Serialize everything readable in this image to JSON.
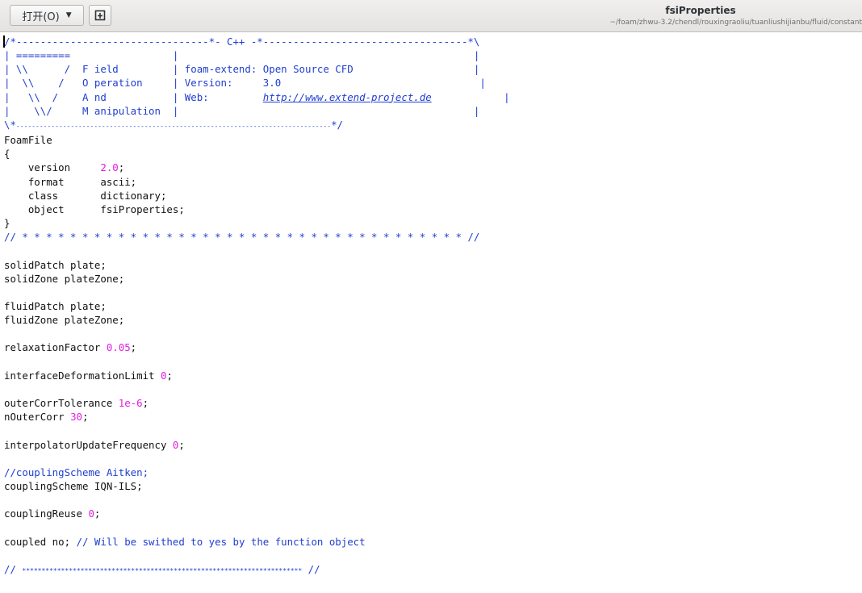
{
  "header": {
    "open_label": "打开(O)",
    "new_tab_icon": "new-document-icon",
    "title": "fsiProperties",
    "subtitle": "~/foam/zhwu-3.2/chendl/rouxingraoliu/tuanliushijianbu/fluid/constant"
  },
  "code": {
    "banner_top": "/*--------------------------------*- C++ -*----------------------------------*\\",
    "banner_l1": "| =========                 |                                                 |",
    "banner_l2a": "| \\\\      /  F ield         | ",
    "banner_l2b": "foam-extend: Open Source CFD",
    "banner_l2c": "                    |",
    "banner_l3a": "|  \\\\    /   O peration     | ",
    "banner_l3b": "Version:     3.0",
    "banner_l3c": "                                 |",
    "banner_l4a": "|   \\\\  /    A nd           | ",
    "banner_l4b": "Web:         ",
    "banner_l4url": "http://www.extend-project.de",
    "banner_l4c": "            |",
    "banner_l5": "|    \\\\/     M anipulation  |                                                 |",
    "banner_bottom_a": "\\*",
    "banner_bottom_dashes": "---------------------------------------------------------------------------------",
    "banner_bottom_b": "*/",
    "foamfile": "FoamFile",
    "open_brace": "{",
    "version_key": "    version     ",
    "version_val": "2.0",
    "format_line": "    format      ascii;",
    "class_line": "    class       dictionary;",
    "object_line": "    object      fsiProperties;",
    "close_brace": "}",
    "stars_line": "// * * * * * * * * * * * * * * * * * * * * * * * * * * * * * * * * * * * * * //",
    "solid_patch": "solidPatch plate;",
    "solid_zone": "solidZone plateZone;",
    "fluid_patch": "fluidPatch plate;",
    "fluid_zone": "fluidZone plateZone;",
    "relax_key": "relaxationFactor ",
    "relax_val": "0.05",
    "idl_key": "interfaceDeformationLimit ",
    "idl_val": "0",
    "oct_key": "outerCorrTolerance ",
    "oct_val": "1e-6",
    "noc_key": "nOuterCorr ",
    "noc_val": "30",
    "iuf_key": "interpolatorUpdateFrequency ",
    "iuf_val": "0",
    "cs_comment": "//couplingScheme Aitken;",
    "cs_line": "couplingScheme IQN-ILS;",
    "cr_key": "couplingReuse ",
    "cr_val": "0",
    "coupled_a": "coupled no; ",
    "coupled_comment": "// Will be swithed to yes by the function object",
    "end_a": "// ",
    "end_stars": "************************************************************************",
    "end_b": " //"
  }
}
